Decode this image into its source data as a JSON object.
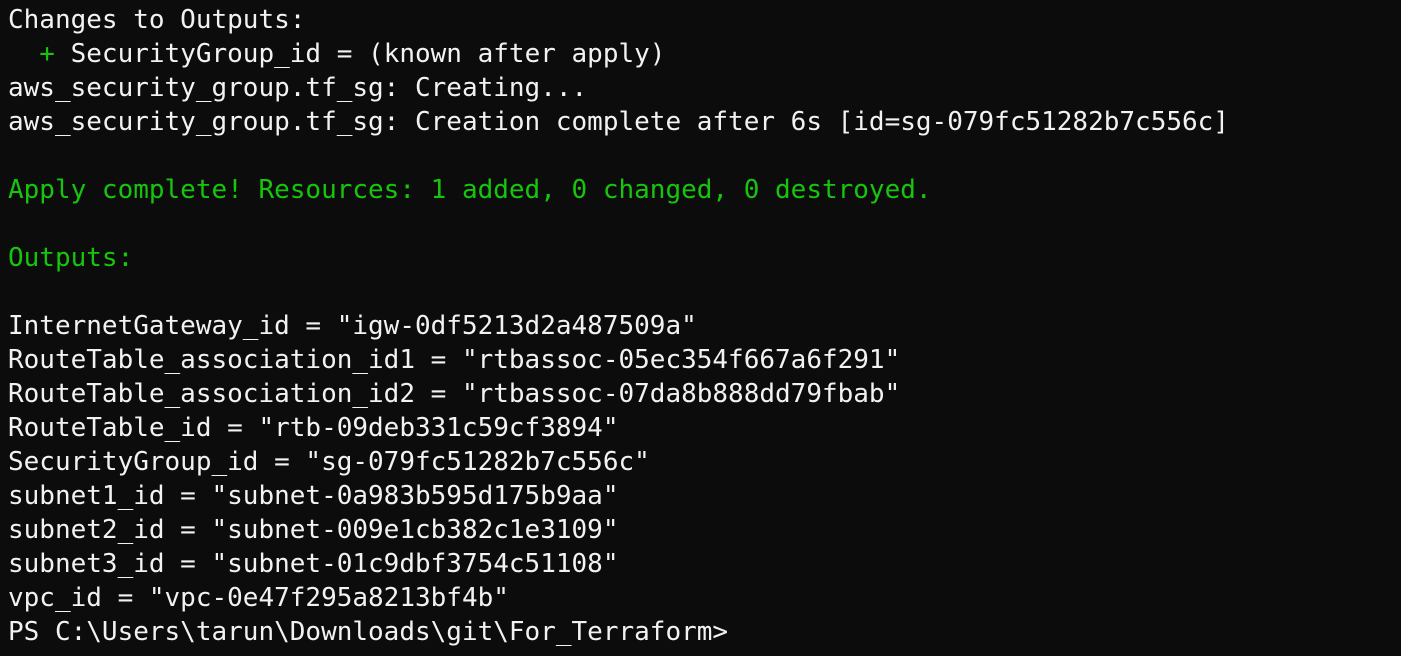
{
  "colors": {
    "background": "#0c0c0c",
    "text": "#f2f2f2",
    "success_green": "#16c60c"
  },
  "terminal": {
    "changes_header": "Changes to Outputs:",
    "change_line": {
      "prefix": "  + ",
      "text": "SecurityGroup_id = (known after apply)"
    },
    "creating_line": "aws_security_group.tf_sg: Creating...",
    "created_line": "aws_security_group.tf_sg: Creation complete after 6s [id=sg-079fc51282b7c556c]",
    "apply_complete": "Apply complete! Resources: 1 added, 0 changed, 0 destroyed.",
    "outputs_header": "Outputs:",
    "outputs": [
      "InternetGateway_id = \"igw-0df5213d2a487509a\"",
      "RouteTable_association_id1 = \"rtbassoc-05ec354f667a6f291\"",
      "RouteTable_association_id2 = \"rtbassoc-07da8b888dd79fbab\"",
      "RouteTable_id = \"rtb-09deb331c59cf3894\"",
      "SecurityGroup_id = \"sg-079fc51282b7c556c\"",
      "subnet1_id = \"subnet-0a983b595d175b9aa\"",
      "subnet2_id = \"subnet-009e1cb382c1e3109\"",
      "subnet3_id = \"subnet-01c9dbf3754c51108\"",
      "vpc_id = \"vpc-0e47f295a8213bf4b\""
    ],
    "prompt": "PS C:\\Users\\tarun\\Downloads\\git\\For_Terraform>"
  }
}
